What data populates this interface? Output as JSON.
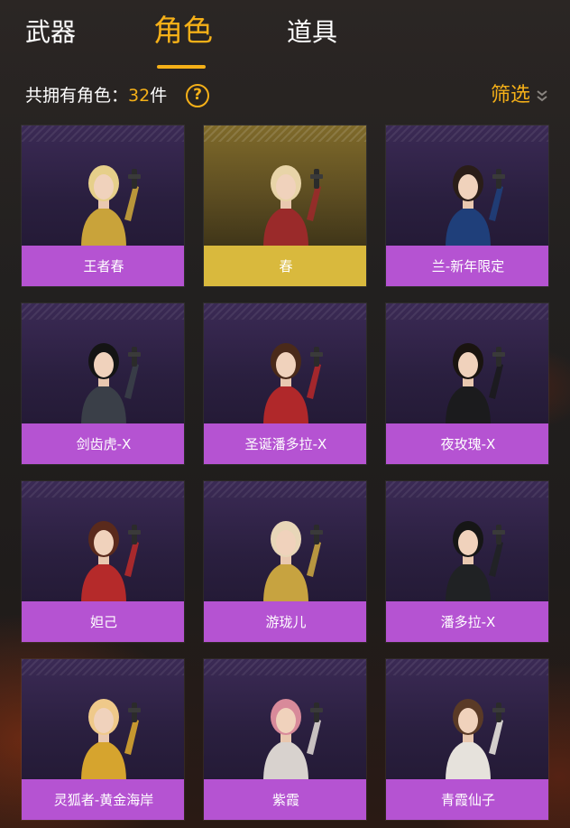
{
  "tabs": [
    {
      "label": "武器",
      "active": false
    },
    {
      "label": "角色",
      "active": true
    },
    {
      "label": "道具",
      "active": false
    }
  ],
  "summary": {
    "prefix": "共拥有角色：",
    "count": "32",
    "suffix": "件",
    "help_icon": "question-circle-icon"
  },
  "filter": {
    "label": "筛选",
    "icon": "double-chevron-down-icon"
  },
  "colors": {
    "accent": "#f5b018",
    "card_name_bar": "#b553d2",
    "card_name_bar_selected": "#d9b93d"
  },
  "characters": [
    {
      "name": "王者春",
      "selected": false,
      "outfit": "#c9a33a",
      "hair": "#e6cf8a"
    },
    {
      "name": "春",
      "selected": true,
      "outfit": "#9a2a2a",
      "hair": "#e8d4a8"
    },
    {
      "name": "兰-新年限定",
      "selected": false,
      "outfit": "#1f3f7a",
      "hair": "#2a1d18"
    },
    {
      "name": "剑齿虎-X",
      "selected": false,
      "outfit": "#3a3f48",
      "hair": "#141414"
    },
    {
      "name": "圣诞潘多拉-X",
      "selected": false,
      "outfit": "#b0282a",
      "hair": "#4a2a1a"
    },
    {
      "name": "夜玫瑰-X",
      "selected": false,
      "outfit": "#1b1b1d",
      "hair": "#1a1410"
    },
    {
      "name": "妲己",
      "selected": false,
      "outfit": "#b52a2a",
      "hair": "#5a2a1c"
    },
    {
      "name": "游珑儿",
      "selected": false,
      "outfit": "#c7a340",
      "hair": "#e8d6b8"
    },
    {
      "name": "潘多拉-X",
      "selected": false,
      "outfit": "#202224",
      "hair": "#161616"
    },
    {
      "name": "灵狐者-黄金海岸",
      "selected": false,
      "outfit": "#d6a42e",
      "hair": "#efc98a"
    },
    {
      "name": "紫霞",
      "selected": false,
      "outfit": "#d8d2ce",
      "hair": "#d88a9a"
    },
    {
      "name": "青霞仙子",
      "selected": false,
      "outfit": "#e6e2dc",
      "hair": "#5a3a26"
    }
  ]
}
